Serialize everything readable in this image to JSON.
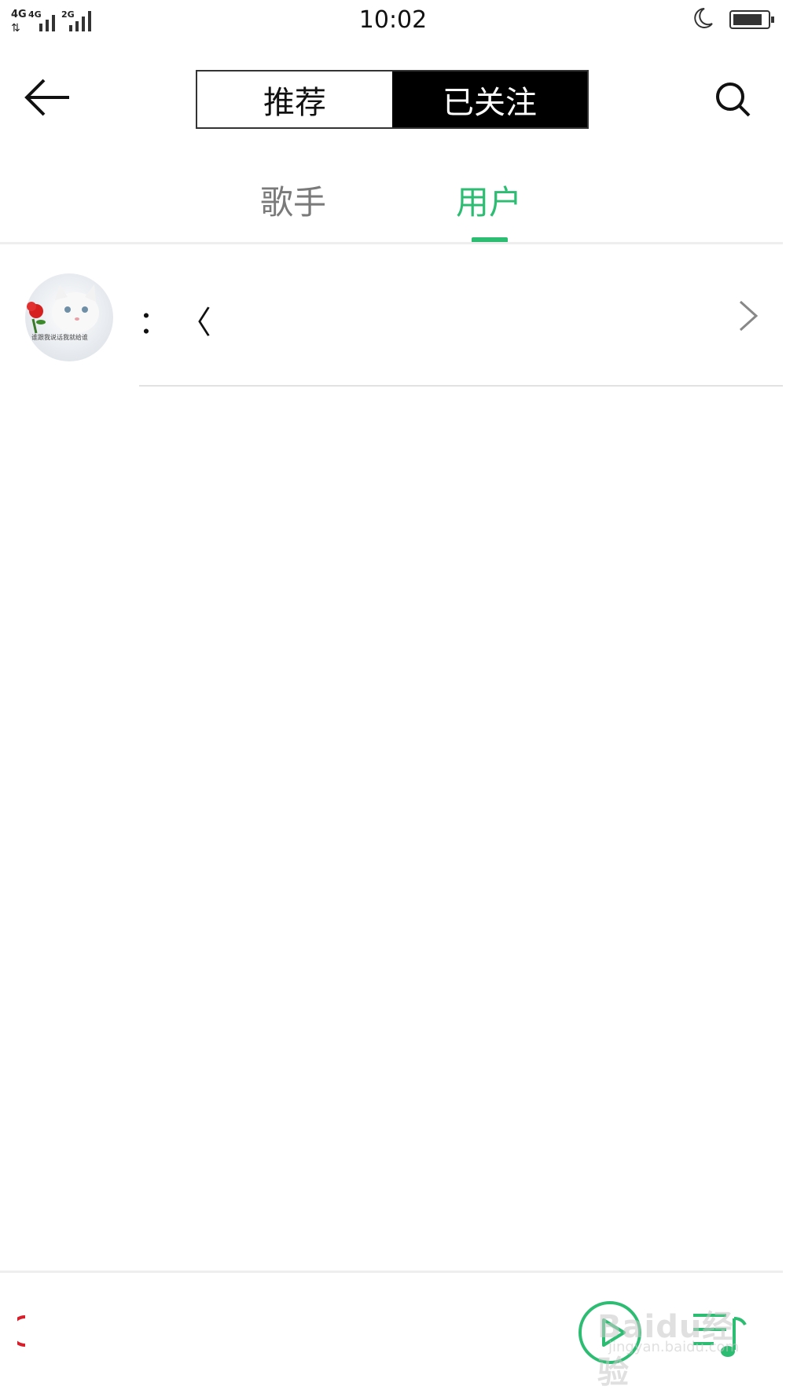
{
  "status_bar": {
    "network_1": "4G",
    "network_2": "4G",
    "network_3": "2G",
    "time": "10:02",
    "icons": [
      "moon-icon",
      "battery-icon"
    ]
  },
  "header": {
    "back_icon": "arrow-left-icon",
    "segments": [
      {
        "label": "推荐",
        "selected": false
      },
      {
        "label": "已关注",
        "selected": true
      }
    ],
    "search_icon": "search-icon"
  },
  "subtabs": [
    {
      "label": "歌手",
      "selected": false
    },
    {
      "label": "用户",
      "selected": true
    }
  ],
  "accent_color": "#2dbd72",
  "followed_users": [
    {
      "name": "：  〈",
      "avatar_icon": "cat-avatar-icon",
      "avatar_caption": "谁跟我说话我就给谁"
    }
  ],
  "player_bar": {
    "play_icon": "play-circle-icon",
    "playlist_icon": "playlist-icon"
  },
  "watermark": {
    "brand": "Baidu经验",
    "url": "jingyan.baidu.com"
  }
}
